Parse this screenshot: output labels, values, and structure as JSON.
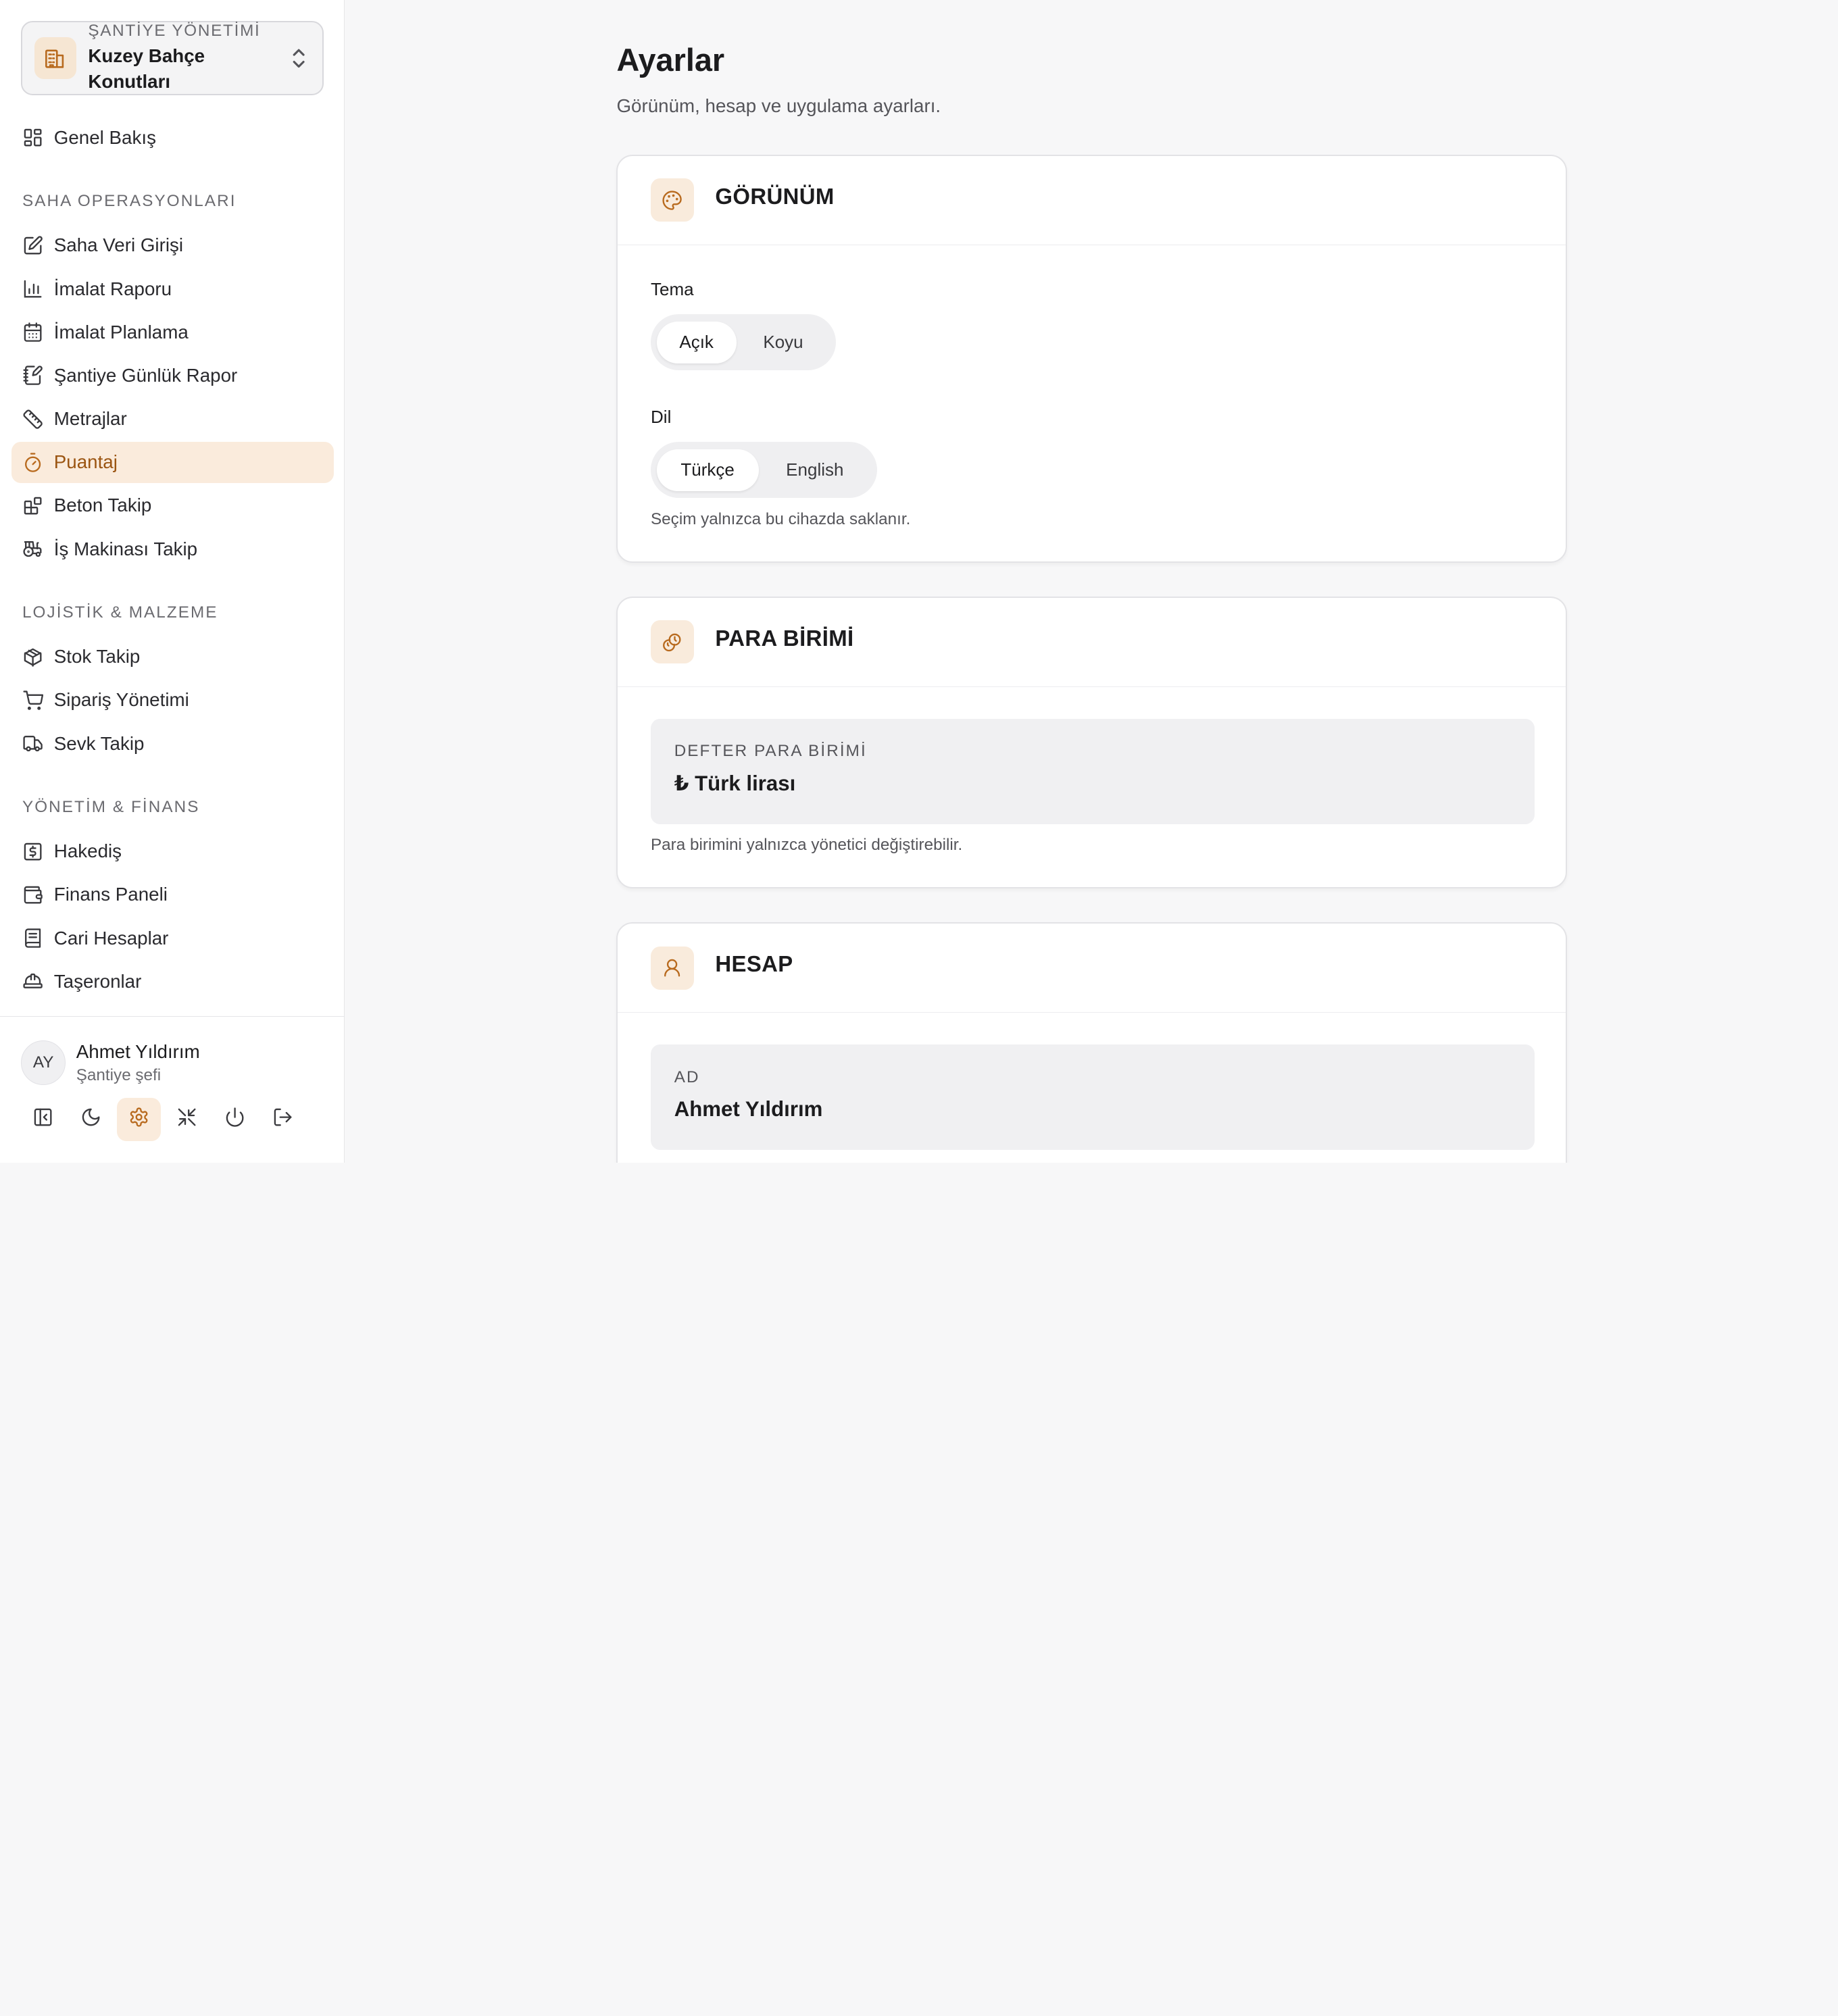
{
  "sidebar": {
    "site_kicker": "ŞANTİYE YÖNETİMİ",
    "site_name": "Kuzey Bahçe Konutları",
    "overview": {
      "label": "Genel Bakış",
      "icon": "grid-icon"
    },
    "sections": [
      {
        "title": "SAHA OPERASYONLARI"
      },
      {
        "title": "LOJİSTİK & MALZEME"
      },
      {
        "title": "YÖNETİM & FİNANS"
      }
    ],
    "items": [
      {
        "label": "Saha Veri Girişi",
        "icon": "edit-icon"
      },
      {
        "label": "İmalat Raporu",
        "icon": "bar-chart-icon"
      },
      {
        "label": "İmalat Planlama",
        "icon": "calendar-icon"
      },
      {
        "label": "Şantiye Günlük Rapor",
        "icon": "notebook-pen-icon"
      },
      {
        "label": "Metrajlar",
        "icon": "ruler-icon"
      },
      {
        "label": "Puantaj",
        "icon": "timer-icon"
      },
      {
        "label": "Beton Takip",
        "icon": "blocks-icon"
      },
      {
        "label": "İş Makinası Takip",
        "icon": "tractor-icon"
      },
      {
        "label": "Stok Takip",
        "icon": "package-icon"
      },
      {
        "label": "Sipariş Yönetimi",
        "icon": "cart-icon"
      },
      {
        "label": "Sevk Takip",
        "icon": "truck-icon"
      },
      {
        "label": "Hakediş",
        "icon": "receipt-dollar-icon"
      },
      {
        "label": "Finans Paneli",
        "icon": "wallet-icon"
      },
      {
        "label": "Cari Hesaplar",
        "icon": "ledger-icon"
      },
      {
        "label": "Taşeronlar",
        "icon": "hard-hat-icon"
      }
    ],
    "active_item": "Puantaj",
    "user": {
      "initials": "AY",
      "name": "Ahmet Yıldırım",
      "role": "Şantiye şefi"
    },
    "tools": [
      "collapse-sidebar-icon",
      "moon-icon",
      "settings-icon",
      "shrink-icon",
      "power-icon",
      "logout-icon"
    ]
  },
  "main": {
    "title": "Ayarlar",
    "subtitle": "Görünüm, hesap ve uygulama ayarları.",
    "appearance": {
      "title": "GÖRÜNÜM",
      "icon": "palette-icon",
      "theme_label": "Tema",
      "theme_options": [
        "Açık",
        "Koyu"
      ],
      "theme_selected": "Açık",
      "language_label": "Dil",
      "language_options": [
        "Türkçe",
        "English"
      ],
      "language_selected": "Türkçe",
      "hint": "Seçim yalnızca bu cihazda saklanır."
    },
    "currency": {
      "title": "PARA BİRİMİ",
      "icon": "coins-icon",
      "field_label": "DEFTER PARA BİRİMİ",
      "field_value": "₺ Türk lirası",
      "hint": "Para birimini yalnızca yönetici değiştirebilir."
    },
    "account": {
      "title": "HESAP",
      "icon": "user-icon",
      "field_label": "AD",
      "field_value": "Ahmet Yıldırım"
    }
  },
  "colors": {
    "accent": "#b86a1e",
    "accent_soft": "#faebdc",
    "text": "#1c1c1e",
    "muted": "#6b6b70"
  }
}
